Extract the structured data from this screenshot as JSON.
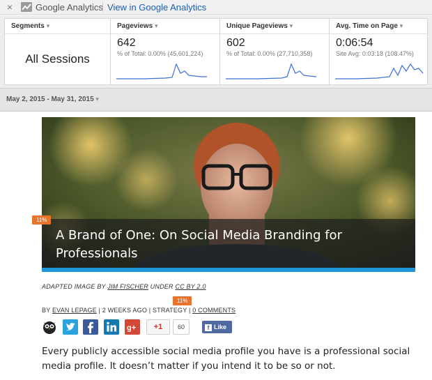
{
  "ga_bar": {
    "close_symbol": "×",
    "product_name": "Google Analytics",
    "view_link": "View in Google Analytics"
  },
  "metrics": {
    "segments": {
      "header": "Segments",
      "value": "All Sessions"
    },
    "pageviews": {
      "header": "Pageviews",
      "value": "642",
      "sub": "% of Total: 0.00% (45,601,224)"
    },
    "unique_pageviews": {
      "header": "Unique Pageviews",
      "value": "602",
      "sub": "% of Total: 0.00% (27,710,358)"
    },
    "avg_time": {
      "header": "Avg. Time on Page",
      "value": "0:06:54",
      "sub": "Site Avg: 0:03:18 (108.47%)"
    },
    "sparkline_color": "#3a6fd8"
  },
  "date_range": "May 2, 2015 - May 31, 2015",
  "article": {
    "title": "A Brand of One: On Social Media Branding for Professionals",
    "title_badge": "11%",
    "credit": {
      "prefix": "ADAPTED IMAGE BY",
      "author": "JIM FISCHER",
      "middle": "UNDER",
      "license": "CC BY 2.0"
    },
    "byline": {
      "by": "BY",
      "author": "EVAN LEPAGE",
      "time": "2 WEEKS AGO",
      "category": "STRATEGY",
      "comments": "0 COMMENTS",
      "badge": "11%"
    },
    "share": {
      "icons": [
        "hootsuite-icon",
        "twitter-icon",
        "facebook-icon",
        "linkedin-icon",
        "google-plus-icon"
      ],
      "gplus_label": "+1",
      "gplus_count": "60",
      "fb_like": "Like"
    },
    "body": "Every publicly accessible social media profile you have is a professional social media profile. It doesn’t matter if you intend it to be so or not."
  },
  "colors": {
    "accent_orange": "#e8742c",
    "accent_blue": "#1d95d6",
    "link_blue": "#1a5db5"
  }
}
